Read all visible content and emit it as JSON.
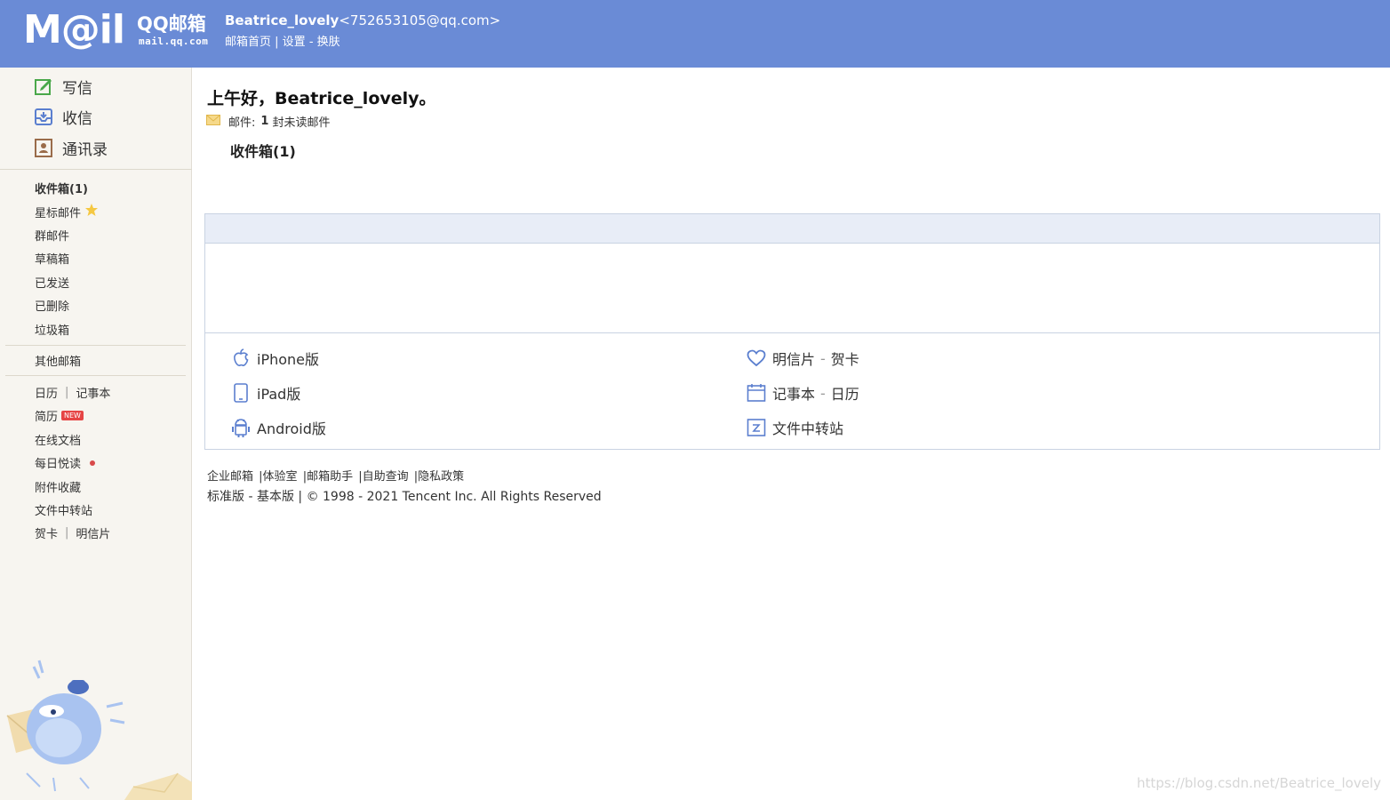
{
  "header": {
    "logo_mail": "M@il",
    "logo_brand": "QQ邮箱",
    "logo_domain": "mail.qq.com",
    "user_name": "Beatrice_lovely",
    "user_email": "<752653105@qq.com>",
    "links": {
      "home": "邮箱首页",
      "sep1": " | ",
      "settings": "设置",
      "sep2": " - ",
      "skin": "换肤"
    }
  },
  "sidebar": {
    "compose": "写信",
    "receive": "收信",
    "contacts": "通讯录",
    "inbox": "收件箱(1)",
    "starred": "星标邮件",
    "group": "群邮件",
    "drafts": "草稿箱",
    "sent": "已发送",
    "deleted": "已删除",
    "spam": "垃圾箱",
    "other": "其他邮箱",
    "calendar": "日历",
    "notes": "记事本",
    "resume": "简历",
    "resume_badge": "NEW",
    "docs": "在线文档",
    "daily": "每日悦读",
    "attachments": "附件收藏",
    "transfer": "文件中转站",
    "cards": "贺卡",
    "postcards": "明信片",
    "pipe": "|"
  },
  "main": {
    "greeting": "上午好，Beatrice_lovely。",
    "mail_label": "邮件:",
    "unread_count": "1",
    "unread_text": "封未读邮件",
    "inbox_link": "收件箱(1)",
    "apps": {
      "iphone": "iPhone版",
      "ipad": "iPad版",
      "android": "Android版",
      "postcard": "明信片",
      "greeting_card": "贺卡",
      "notebook": "记事本",
      "calendar": "日历",
      "transfer": "文件中转站",
      "dash": "-"
    }
  },
  "footer": {
    "enterprise": "企业邮箱",
    "lab": "|体验室",
    "helper": "|邮箱助手",
    "selfquery": "|自助查询",
    "privacy": "|隐私政策",
    "standard": "标准版",
    "dash": " - ",
    "basic": "基本版",
    "copyright": " | © 1998 - 2021 Tencent Inc. All Rights Reserved"
  },
  "watermark": "https://blog.csdn.net/Beatrice_lovely",
  "colors": {
    "header_bg": "#6a8bd6",
    "sidebar_bg": "#f7f5f0",
    "panel_bar": "#e8edf7"
  }
}
